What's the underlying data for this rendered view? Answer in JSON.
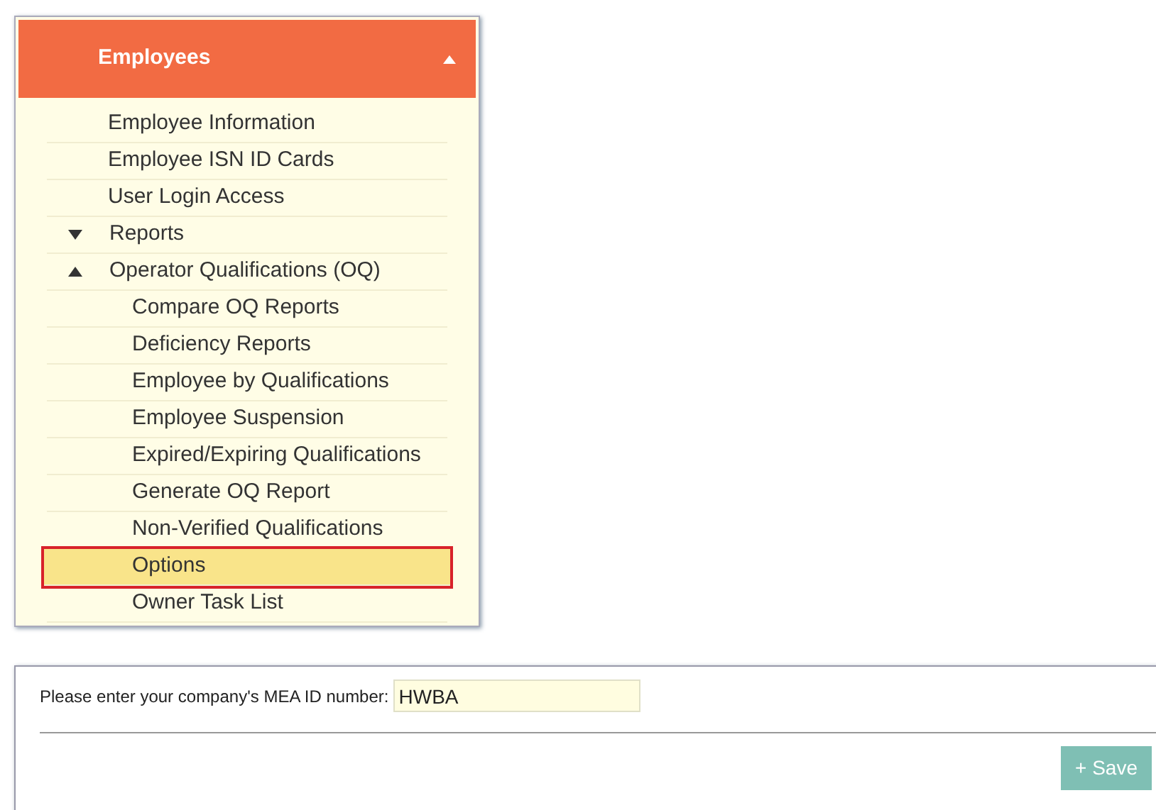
{
  "menu": {
    "title": "Employees",
    "expanded": true,
    "items": [
      {
        "kind": "link",
        "label": "Employee Information",
        "selected": false
      },
      {
        "kind": "link",
        "label": "Employee ISN ID Cards",
        "selected": false
      },
      {
        "kind": "link",
        "label": "User Login Access",
        "selected": false
      },
      {
        "kind": "group",
        "label": "Reports",
        "expanded": false
      },
      {
        "kind": "group",
        "label": "Operator Qualifications (OQ)",
        "expanded": true,
        "children": [
          {
            "label": "Compare OQ Reports",
            "selected": false
          },
          {
            "label": "Deficiency Reports",
            "selected": false
          },
          {
            "label": "Employee by Qualifications",
            "selected": false
          },
          {
            "label": "Employee Suspension",
            "selected": false
          },
          {
            "label": "Expired/Expiring Qualifications",
            "selected": false
          },
          {
            "label": "Generate OQ Report",
            "selected": false
          },
          {
            "label": "Non-Verified Qualifications",
            "selected": false
          },
          {
            "label": "Options",
            "selected": true
          },
          {
            "label": "Owner Task List",
            "selected": false
          }
        ]
      }
    ]
  },
  "form": {
    "label": "Please enter your company's MEA ID number:",
    "value": "HWBA",
    "button": "+ Save"
  }
}
